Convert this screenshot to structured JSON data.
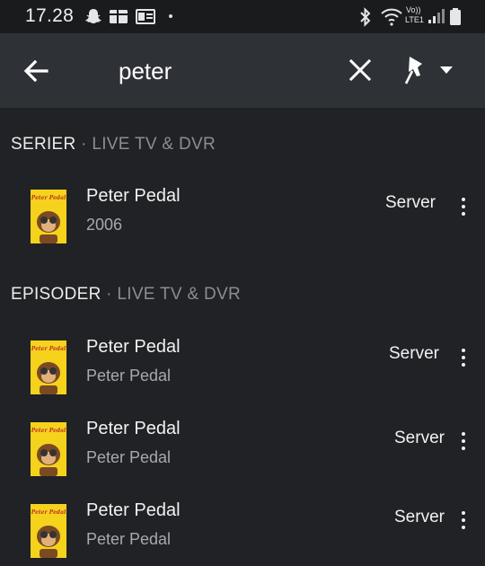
{
  "status_bar": {
    "time": "17.28",
    "volte_label": "Vo))",
    "lte_label": "LTE1"
  },
  "search": {
    "query": "peter"
  },
  "sections": [
    {
      "title": "SERIER",
      "subtitle": " · LIVE TV & DVR"
    },
    {
      "title": "EPISODER",
      "subtitle": " · LIVE TV & DVR"
    }
  ],
  "series_items": [
    {
      "thumb_text": "Peter Pedal",
      "title": "Peter Pedal",
      "subtitle": "2006",
      "source": "Server"
    }
  ],
  "episode_items": [
    {
      "thumb_text": "Peter Pedal",
      "title": "Peter Pedal",
      "subtitle": "Peter Pedal",
      "source": "Server"
    },
    {
      "thumb_text": "Peter Pedal",
      "title": "Peter Pedal",
      "subtitle": "Peter Pedal",
      "source": "Server"
    },
    {
      "thumb_text": "Peter Pedal",
      "title": "Peter Pedal",
      "subtitle": "Peter Pedal",
      "source": "Server"
    }
  ],
  "colors": {
    "background": "#202225",
    "toolbar": "#2e3135",
    "thumbnail": "#f5d31c"
  }
}
